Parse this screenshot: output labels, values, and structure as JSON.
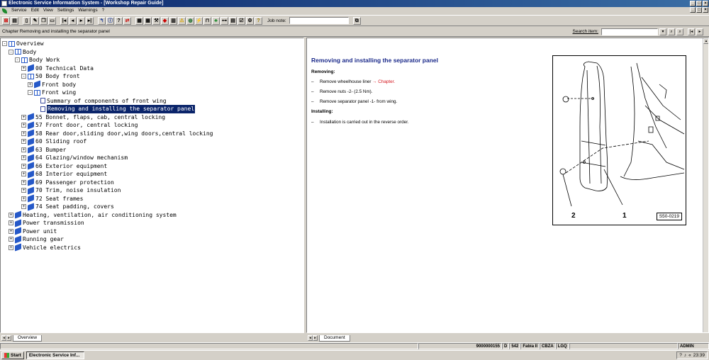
{
  "window": {
    "title": "Electronic Service Information System - [Workshop Repair Guide]"
  },
  "menu": [
    "Service",
    "Edit",
    "View",
    "Settings",
    "Warnings",
    "?"
  ],
  "toolbar": {
    "job_note_label": "Job note:",
    "job_note_value": ""
  },
  "chapter_bar": {
    "text": "Chapter Removing and installing the separator panel",
    "search_label": "Search item:",
    "search_value": ""
  },
  "tree": [
    {
      "label": "Overview",
      "level": 0,
      "exp": "-",
      "icon": "open"
    },
    {
      "label": "Body",
      "level": 1,
      "exp": "-",
      "icon": "open"
    },
    {
      "label": "Body Work",
      "level": 2,
      "exp": "-",
      "icon": "open"
    },
    {
      "label": "00 Technical Data",
      "level": 3,
      "exp": "+",
      "icon": "closed"
    },
    {
      "label": "50 Body front",
      "level": 3,
      "exp": "-",
      "icon": "open"
    },
    {
      "label": "Front body",
      "level": 4,
      "exp": "+",
      "icon": "closed"
    },
    {
      "label": "Front wing",
      "level": 4,
      "exp": "-",
      "icon": "open"
    },
    {
      "label": "Summary of components of front wing",
      "level": 5,
      "exp": "",
      "icon": "doc"
    },
    {
      "label": "Removing and installing the separator panel",
      "level": 5,
      "exp": "",
      "icon": "doc",
      "selected": true
    },
    {
      "label": "55 Bonnet, flaps, cab, central locking",
      "level": 3,
      "exp": "+",
      "icon": "closed"
    },
    {
      "label": "57 Front door, central locking",
      "level": 3,
      "exp": "+",
      "icon": "closed"
    },
    {
      "label": "58 Rear door,sliding door,wing doors,central locking",
      "level": 3,
      "exp": "+",
      "icon": "closed"
    },
    {
      "label": "60 Sliding roof",
      "level": 3,
      "exp": "+",
      "icon": "closed"
    },
    {
      "label": "63 Bumper",
      "level": 3,
      "exp": "+",
      "icon": "closed"
    },
    {
      "label": "64 Glazing/window mechanism",
      "level": 3,
      "exp": "+",
      "icon": "closed"
    },
    {
      "label": "66 Exterior equipment",
      "level": 3,
      "exp": "+",
      "icon": "closed"
    },
    {
      "label": "68 Interior equipment",
      "level": 3,
      "exp": "+",
      "icon": "closed"
    },
    {
      "label": "69 Passenger protection",
      "level": 3,
      "exp": "+",
      "icon": "closed"
    },
    {
      "label": "70 Trim, noise insulation",
      "level": 3,
      "exp": "+",
      "icon": "closed"
    },
    {
      "label": "72 Seat frames",
      "level": 3,
      "exp": "+",
      "icon": "closed"
    },
    {
      "label": "74 Seat padding, covers",
      "level": 3,
      "exp": "+",
      "icon": "closed"
    },
    {
      "label": "Heating, ventilation, air conditioning system",
      "level": 1,
      "exp": "+",
      "icon": "closed"
    },
    {
      "label": "Power transmission",
      "level": 1,
      "exp": "+",
      "icon": "closed"
    },
    {
      "label": "Power unit",
      "level": 1,
      "exp": "+",
      "icon": "closed"
    },
    {
      "label": "Running gear",
      "level": 1,
      "exp": "+",
      "icon": "closed"
    },
    {
      "label": "Vehicle electrics",
      "level": 1,
      "exp": "+",
      "icon": "closed"
    }
  ],
  "left_tab": "Overview",
  "right_tab": "Document",
  "document": {
    "title": "Removing and installing the separator panel",
    "removing_heading": "Removing:",
    "step1_text": "Remove wheelhouse liner",
    "step1_link": "→ Chapter.",
    "step2": "Remove nuts -2- (2.5 Nm).",
    "step3": "Remove separator panel -1- from wing.",
    "installing_heading": "Installing:",
    "step4": "Installation is carried out in the reverse order.",
    "dash": "–",
    "figure_label_1": "1",
    "figure_label_2": "2",
    "figure_code": "S50-0219"
  },
  "status": {
    "s1": "9000000155",
    "s2": "D",
    "s3": "542",
    "s4": "Fabia II",
    "s5": "CBZA",
    "s6": "LGQ",
    "s7": "ADMIN"
  },
  "taskbar": {
    "start": "Start",
    "task": "Electronic Service Inf...",
    "clock": "23:39"
  }
}
